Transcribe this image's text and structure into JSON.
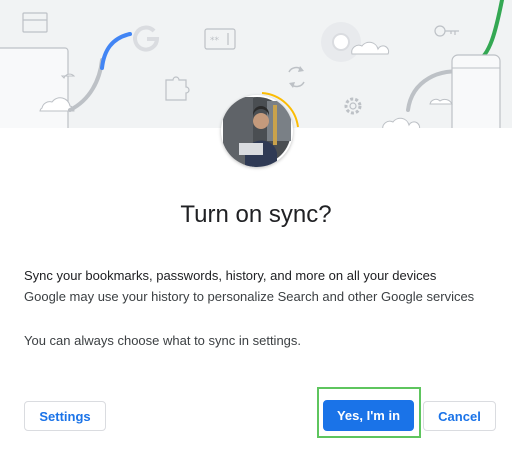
{
  "dialog": {
    "title": "Turn on sync?",
    "description_line1": "Sync your bookmarks, passwords, history, and more on all your devices",
    "description_line2": "Google may use your history to personalize Search and other Google services",
    "settings_note": "You can always choose what to sync in settings."
  },
  "buttons": {
    "settings_label": "Settings",
    "confirm_label": "Yes, I'm in",
    "cancel_label": "Cancel"
  },
  "banner": {
    "icons": [
      "card-icon",
      "laptop-icon",
      "google-logo-icon",
      "puzzle-icon",
      "password-icon",
      "sync-icon",
      "chrome-icon",
      "gear-icon",
      "key-icon",
      "phone-icon",
      "cloud-icon"
    ]
  },
  "colors": {
    "accent": "#1a73e8",
    "highlight": "#5ec55e",
    "banner_bg": "#f1f3f4",
    "green_line": "#34a853",
    "blue_line": "#4285f4"
  }
}
